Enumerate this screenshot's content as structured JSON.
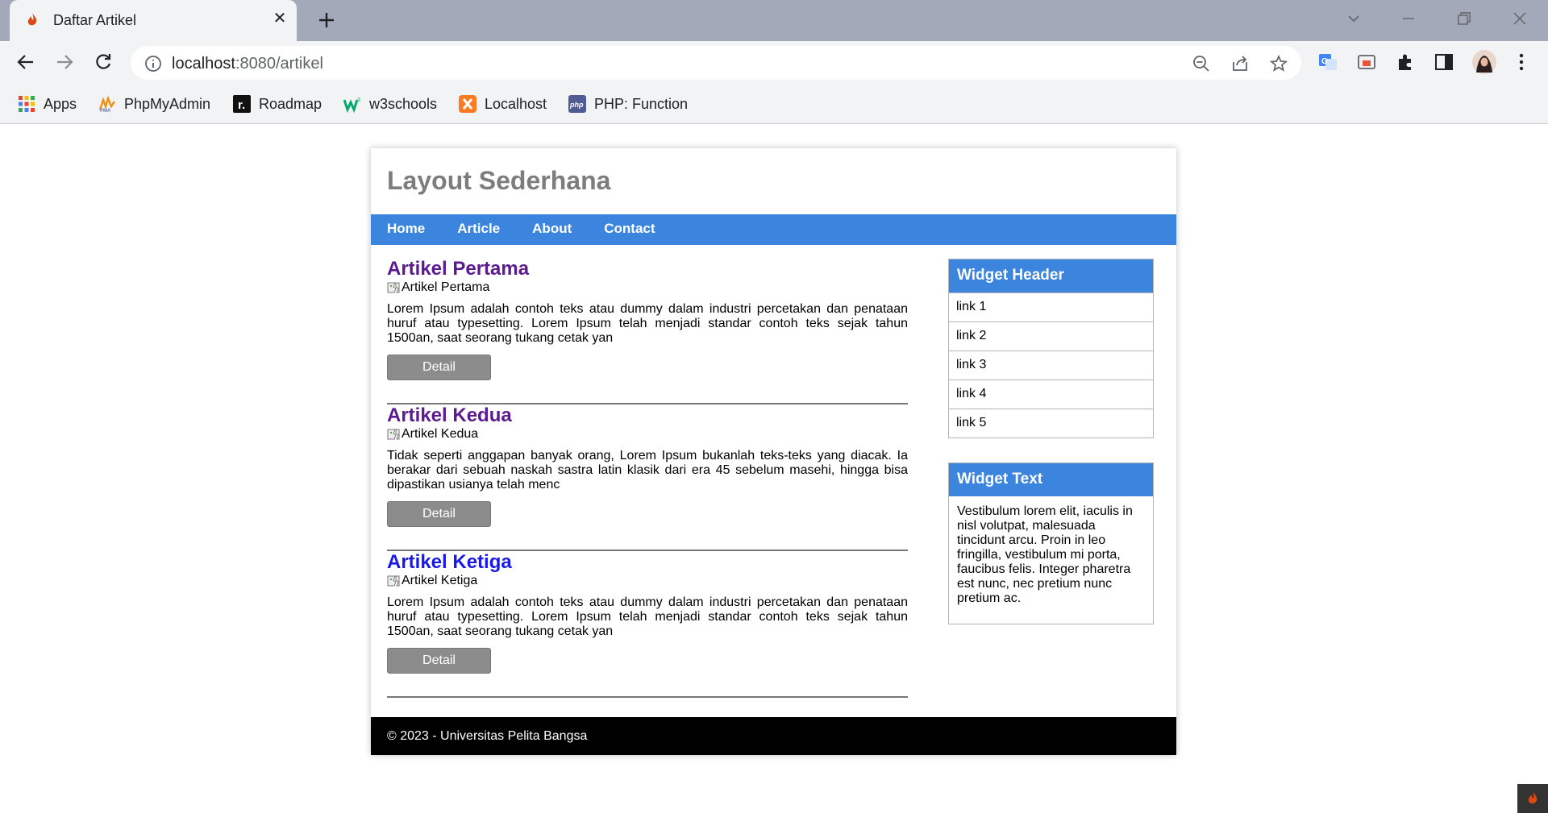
{
  "browser": {
    "tab_title": "Daftar Artikel",
    "url_host": "localhost",
    "url_path": ":8080/artikel",
    "bookmarks": [
      {
        "label": "Apps",
        "icon": "apps-grid-icon"
      },
      {
        "label": "PhpMyAdmin",
        "icon": "phpmyadmin-icon"
      },
      {
        "label": "Roadmap",
        "icon": "roadmap-icon"
      },
      {
        "label": "w3schools",
        "icon": "w3schools-icon"
      },
      {
        "label": "Localhost",
        "icon": "xampp-icon"
      },
      {
        "label": "PHP: Function",
        "icon": "php-icon"
      }
    ]
  },
  "site": {
    "title": "Layout Sederhana",
    "nav": [
      "Home",
      "Article",
      "About",
      "Contact"
    ],
    "articles": [
      {
        "title": "Artikel Pertama",
        "img_alt": "Artikel Pertama",
        "text": "Lorem Ipsum adalah contoh teks atau dummy dalam industri percetakan dan penataan huruf atau typesetting. Lorem Ipsum telah menjadi standar contoh teks sejak tahun 1500an, saat seorang tukang cetak yan",
        "button": "Detail"
      },
      {
        "title": "Artikel Kedua",
        "img_alt": "Artikel Kedua",
        "text": "Tidak seperti anggapan banyak orang, Lorem Ipsum bukanlah teks-teks yang diacak. Ia berakar dari sebuah naskah sastra latin klasik dari era 45 sebelum masehi, hingga bisa dipastikan usianya telah menc",
        "button": "Detail"
      },
      {
        "title": "Artikel Ketiga",
        "img_alt": "Artikel Ketiga",
        "text": "Lorem Ipsum adalah contoh teks atau dummy dalam industri percetakan dan penataan huruf atau typesetting. Lorem Ipsum telah menjadi standar contoh teks sejak tahun 1500an, saat seorang tukang cetak yan",
        "button": "Detail"
      }
    ],
    "widget_links": {
      "header": "Widget Header",
      "links": [
        "link 1",
        "link 2",
        "link 3",
        "link 4",
        "link 5"
      ]
    },
    "widget_text": {
      "header": "Widget Text",
      "body": "Vestibulum lorem elit, iaculis in nisl volutpat, malesuada tincidunt arcu. Proin in leo fringilla, vestibulum mi porta, faucibus felis. Integer pharetra est nunc, nec pretium nunc pretium ac."
    },
    "footer": "© 2023 - Universitas Pelita Bangsa"
  },
  "colors": {
    "nav_blue": "#3b85df",
    "visited_link": "#5b1a8f",
    "link": "#1a1ae6",
    "title_gray": "#7d7d7d"
  }
}
